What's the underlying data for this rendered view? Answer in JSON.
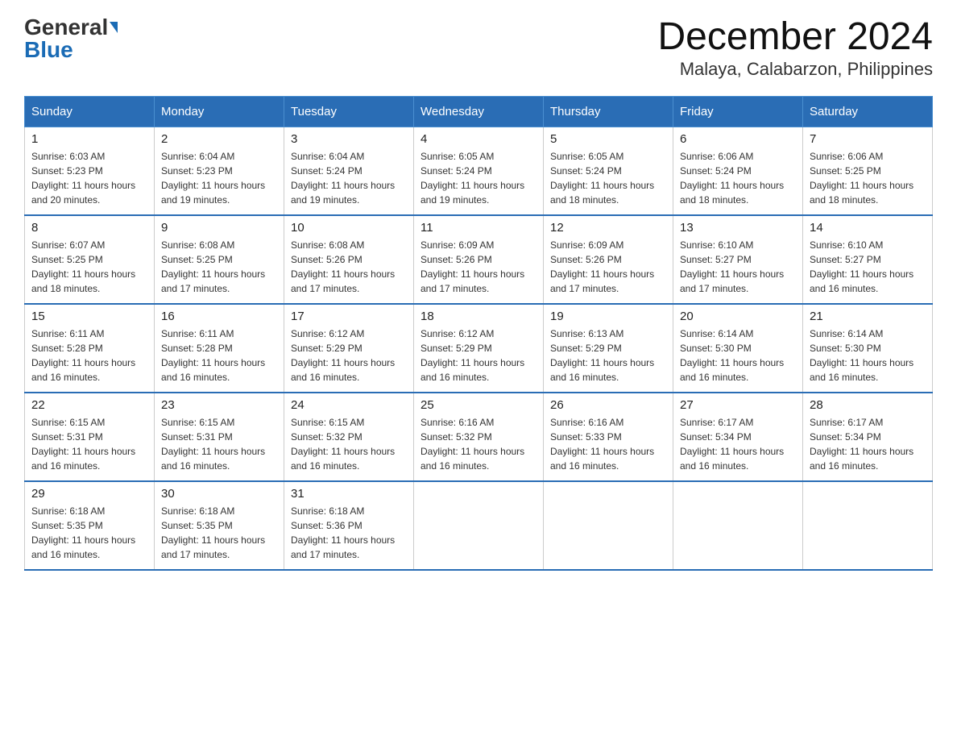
{
  "header": {
    "logo_general": "General",
    "logo_blue": "Blue",
    "month_title": "December 2024",
    "location": "Malaya, Calabarzon, Philippines"
  },
  "days_of_week": [
    "Sunday",
    "Monday",
    "Tuesday",
    "Wednesday",
    "Thursday",
    "Friday",
    "Saturday"
  ],
  "weeks": [
    [
      {
        "day": "1",
        "sunrise": "6:03 AM",
        "sunset": "5:23 PM",
        "daylight": "11 hours and 20 minutes."
      },
      {
        "day": "2",
        "sunrise": "6:04 AM",
        "sunset": "5:23 PM",
        "daylight": "11 hours and 19 minutes."
      },
      {
        "day": "3",
        "sunrise": "6:04 AM",
        "sunset": "5:24 PM",
        "daylight": "11 hours and 19 minutes."
      },
      {
        "day": "4",
        "sunrise": "6:05 AM",
        "sunset": "5:24 PM",
        "daylight": "11 hours and 19 minutes."
      },
      {
        "day": "5",
        "sunrise": "6:05 AM",
        "sunset": "5:24 PM",
        "daylight": "11 hours and 18 minutes."
      },
      {
        "day": "6",
        "sunrise": "6:06 AM",
        "sunset": "5:24 PM",
        "daylight": "11 hours and 18 minutes."
      },
      {
        "day": "7",
        "sunrise": "6:06 AM",
        "sunset": "5:25 PM",
        "daylight": "11 hours and 18 minutes."
      }
    ],
    [
      {
        "day": "8",
        "sunrise": "6:07 AM",
        "sunset": "5:25 PM",
        "daylight": "11 hours and 18 minutes."
      },
      {
        "day": "9",
        "sunrise": "6:08 AM",
        "sunset": "5:25 PM",
        "daylight": "11 hours and 17 minutes."
      },
      {
        "day": "10",
        "sunrise": "6:08 AM",
        "sunset": "5:26 PM",
        "daylight": "11 hours and 17 minutes."
      },
      {
        "day": "11",
        "sunrise": "6:09 AM",
        "sunset": "5:26 PM",
        "daylight": "11 hours and 17 minutes."
      },
      {
        "day": "12",
        "sunrise": "6:09 AM",
        "sunset": "5:26 PM",
        "daylight": "11 hours and 17 minutes."
      },
      {
        "day": "13",
        "sunrise": "6:10 AM",
        "sunset": "5:27 PM",
        "daylight": "11 hours and 17 minutes."
      },
      {
        "day": "14",
        "sunrise": "6:10 AM",
        "sunset": "5:27 PM",
        "daylight": "11 hours and 16 minutes."
      }
    ],
    [
      {
        "day": "15",
        "sunrise": "6:11 AM",
        "sunset": "5:28 PM",
        "daylight": "11 hours and 16 minutes."
      },
      {
        "day": "16",
        "sunrise": "6:11 AM",
        "sunset": "5:28 PM",
        "daylight": "11 hours and 16 minutes."
      },
      {
        "day": "17",
        "sunrise": "6:12 AM",
        "sunset": "5:29 PM",
        "daylight": "11 hours and 16 minutes."
      },
      {
        "day": "18",
        "sunrise": "6:12 AM",
        "sunset": "5:29 PM",
        "daylight": "11 hours and 16 minutes."
      },
      {
        "day": "19",
        "sunrise": "6:13 AM",
        "sunset": "5:29 PM",
        "daylight": "11 hours and 16 minutes."
      },
      {
        "day": "20",
        "sunrise": "6:14 AM",
        "sunset": "5:30 PM",
        "daylight": "11 hours and 16 minutes."
      },
      {
        "day": "21",
        "sunrise": "6:14 AM",
        "sunset": "5:30 PM",
        "daylight": "11 hours and 16 minutes."
      }
    ],
    [
      {
        "day": "22",
        "sunrise": "6:15 AM",
        "sunset": "5:31 PM",
        "daylight": "11 hours and 16 minutes."
      },
      {
        "day": "23",
        "sunrise": "6:15 AM",
        "sunset": "5:31 PM",
        "daylight": "11 hours and 16 minutes."
      },
      {
        "day": "24",
        "sunrise": "6:15 AM",
        "sunset": "5:32 PM",
        "daylight": "11 hours and 16 minutes."
      },
      {
        "day": "25",
        "sunrise": "6:16 AM",
        "sunset": "5:32 PM",
        "daylight": "11 hours and 16 minutes."
      },
      {
        "day": "26",
        "sunrise": "6:16 AM",
        "sunset": "5:33 PM",
        "daylight": "11 hours and 16 minutes."
      },
      {
        "day": "27",
        "sunrise": "6:17 AM",
        "sunset": "5:34 PM",
        "daylight": "11 hours and 16 minutes."
      },
      {
        "day": "28",
        "sunrise": "6:17 AM",
        "sunset": "5:34 PM",
        "daylight": "11 hours and 16 minutes."
      }
    ],
    [
      {
        "day": "29",
        "sunrise": "6:18 AM",
        "sunset": "5:35 PM",
        "daylight": "11 hours and 16 minutes."
      },
      {
        "day": "30",
        "sunrise": "6:18 AM",
        "sunset": "5:35 PM",
        "daylight": "11 hours and 17 minutes."
      },
      {
        "day": "31",
        "sunrise": "6:18 AM",
        "sunset": "5:36 PM",
        "daylight": "11 hours and 17 minutes."
      },
      null,
      null,
      null,
      null
    ]
  ]
}
